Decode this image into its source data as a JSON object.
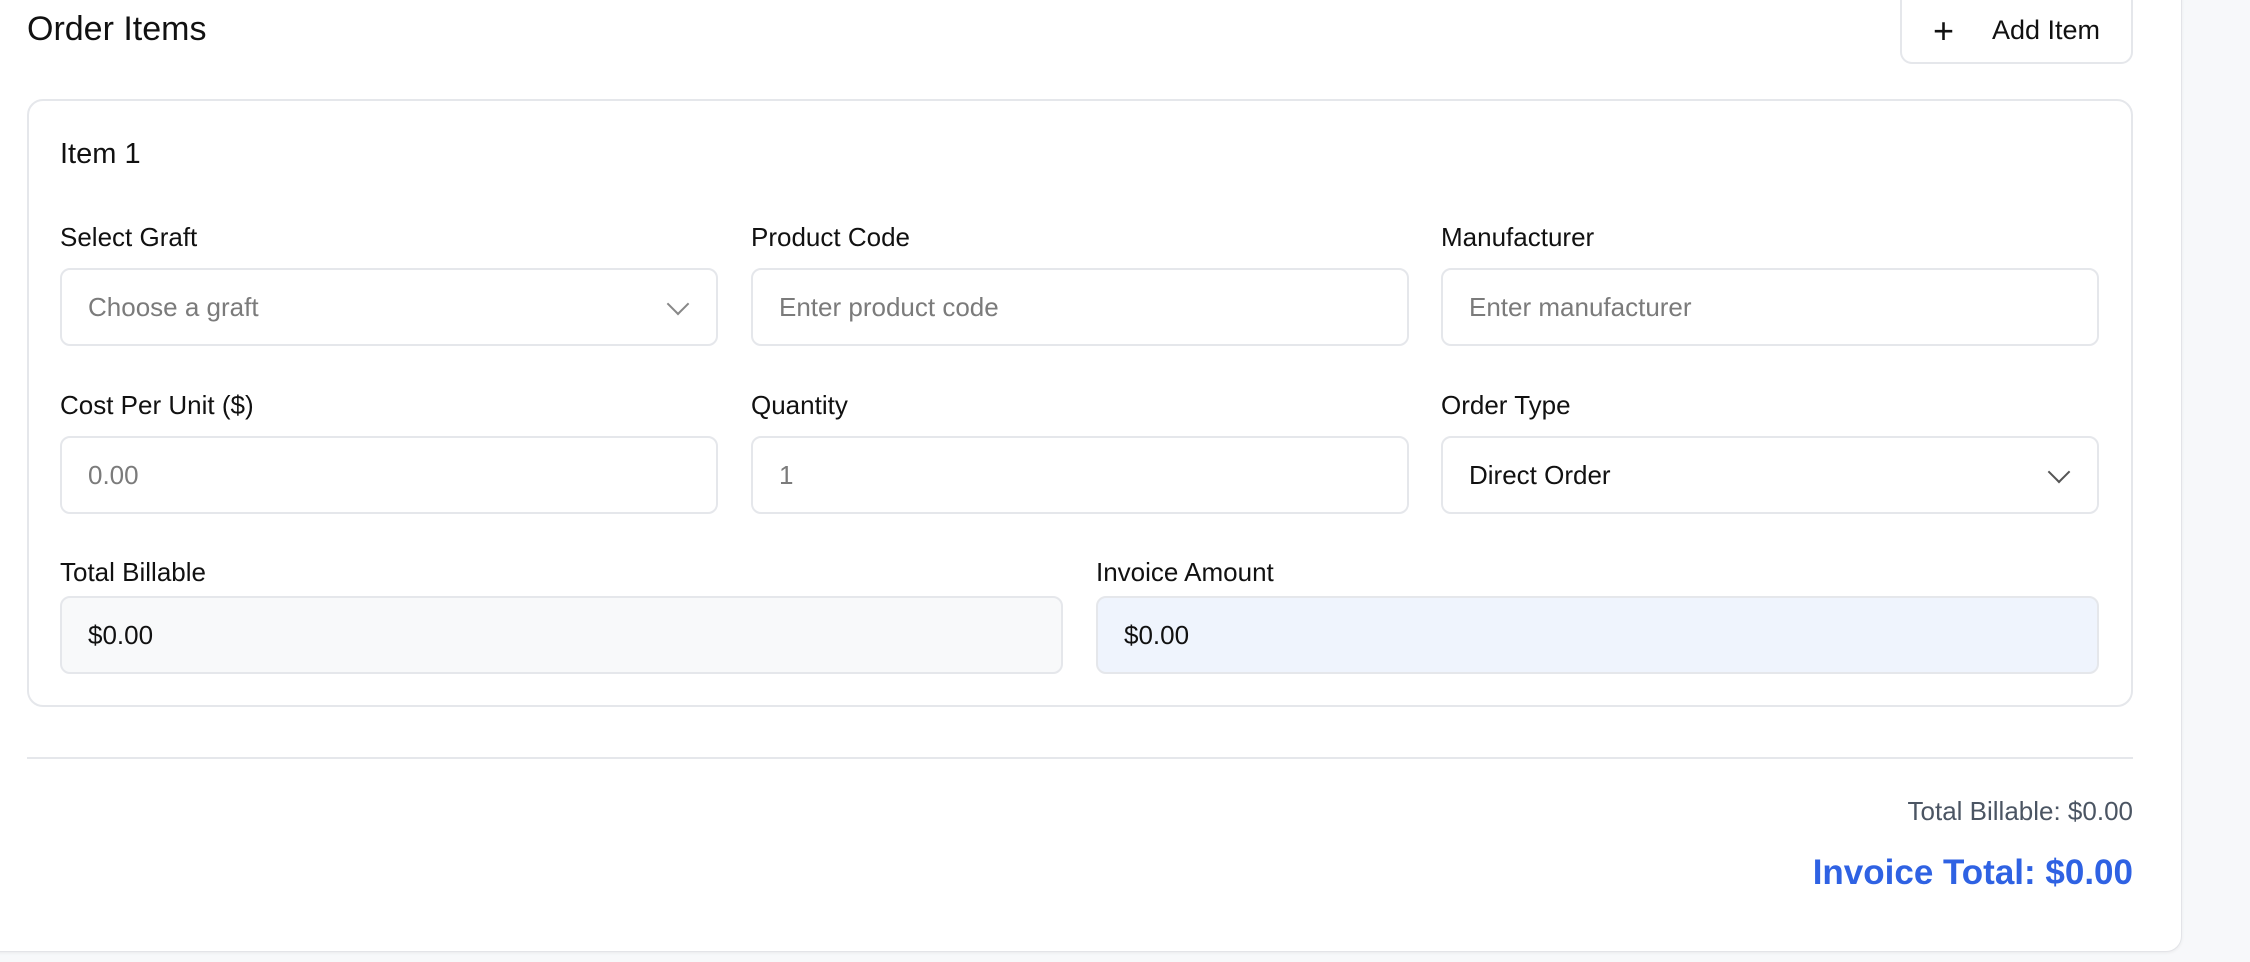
{
  "header": {
    "title": "Order Items",
    "add_item_label": "Add Item"
  },
  "item": {
    "title": "Item 1",
    "select_graft": {
      "label": "Select Graft",
      "placeholder": "Choose a graft"
    },
    "product_code": {
      "label": "Product Code",
      "placeholder": "Enter product code"
    },
    "manufacturer": {
      "label": "Manufacturer",
      "placeholder": "Enter manufacturer"
    },
    "cost_per_unit": {
      "label": "Cost Per Unit ($)",
      "placeholder": "0.00"
    },
    "quantity": {
      "label": "Quantity",
      "value": "1"
    },
    "order_type": {
      "label": "Order Type",
      "value": "Direct Order"
    },
    "total_billable": {
      "label": "Total Billable",
      "value": "$0.00"
    },
    "invoice_amount": {
      "label": "Invoice Amount",
      "value": "$0.00"
    }
  },
  "summary": {
    "total_billable": "Total Billable: $0.00",
    "invoice_total": "Invoice Total: $0.00"
  },
  "colors": {
    "accent": "#2f62e3",
    "invoice_bg": "#eff4fd",
    "readonly_bg": "#f8f9fa"
  }
}
